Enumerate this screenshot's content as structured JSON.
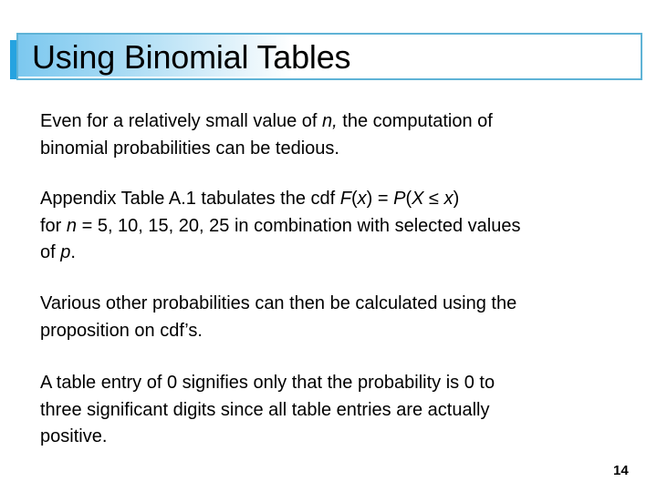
{
  "slide": {
    "title": "Using Binomial Tables",
    "page_number": "14",
    "colors": {
      "title_border": "#5fb3d6",
      "title_accent": "#26a3e0",
      "title_gradient_start": "#7cc8ef",
      "title_gradient_end": "#ffffff",
      "text": "#000000"
    }
  },
  "paragraphs": {
    "p1": {
      "l1_a": "Even for a relatively small value of ",
      "l1_n": "n,",
      "l1_b": " the computation of",
      "l2": "binomial probabilities can be tedious."
    },
    "p2": {
      "l1_a": "Appendix Table A.1 tabulates the cdf ",
      "l1_F": "F",
      "l1_p1": "(",
      "l1_x1": "x",
      "l1_p2": ") = ",
      "l1_P": "P",
      "l1_p3": "(",
      "l1_X": "X",
      "l1_le": " ≤ ",
      "l1_x2": "x",
      "l1_p4": ")",
      "l2_a": "for ",
      "l2_n": "n",
      "l2_b": " = 5, 10, 15, 20, 25 in combination with selected values",
      "l3_a": "of ",
      "l3_p": "p",
      "l3_b": "."
    },
    "p3": {
      "l1": "Various other probabilities can then be calculated using the",
      "l2": "proposition on cdf’s."
    },
    "p4": {
      "l1": "A table entry of 0 signifies only that the probability is 0 to",
      "l2": "three significant digits since all table entries are actually",
      "l3": "positive."
    }
  }
}
